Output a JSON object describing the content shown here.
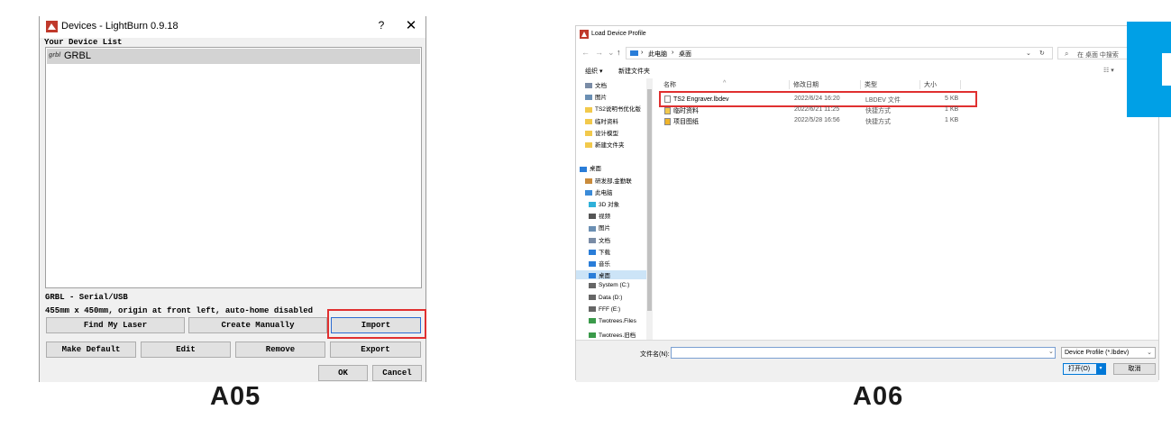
{
  "left_dialog": {
    "title": "Devices - LightBurn 0.9.18",
    "help_glyph": "?",
    "close_glyph": "✕",
    "list_label": "Your Device List",
    "devices": [
      {
        "icon_text": "grbl",
        "name": "GRBL"
      }
    ],
    "selected_device_info": "GRBL - Serial/USB",
    "device_details": "455mm x 450mm, origin at front left, auto-home disabled",
    "buttons": {
      "find_my_laser": "Find My Laser",
      "create_manually": "Create Manually",
      "import": "Import",
      "make_default": "Make Default",
      "edit": "Edit",
      "remove": "Remove",
      "export": "Export",
      "ok": "OK",
      "cancel": "Cancel"
    },
    "caption": "A05"
  },
  "right_dialog": {
    "title": "Load Device Profile",
    "breadcrumb": [
      "此电脑",
      "桌面"
    ],
    "search_placeholder": "在 桌面 中搜索",
    "toolbar": {
      "organize": "组织 ▾",
      "new_folder": "新建文件夹"
    },
    "nav_tree": [
      {
        "label": "文档",
        "icon": "document-icon"
      },
      {
        "label": "图片",
        "icon": "picture-icon"
      },
      {
        "label": "TS2说明书优化版",
        "icon": "folder-icon"
      },
      {
        "label": "临时资料",
        "icon": "folder-icon"
      },
      {
        "label": "设计模型",
        "icon": "folder-icon"
      },
      {
        "label": "新建文件夹",
        "icon": "folder-icon"
      },
      {
        "label": "桌面",
        "icon": "desktop-icon"
      },
      {
        "label": "研发部,金勤联",
        "icon": "user-icon"
      },
      {
        "label": "此电脑",
        "icon": "computer-icon"
      },
      {
        "label": "3D 对象",
        "icon": "cube-icon"
      },
      {
        "label": "视频",
        "icon": "video-icon"
      },
      {
        "label": "图片",
        "icon": "picture-icon"
      },
      {
        "label": "文档",
        "icon": "document-icon"
      },
      {
        "label": "下载",
        "icon": "download-icon"
      },
      {
        "label": "音乐",
        "icon": "music-icon"
      },
      {
        "label": "桌面",
        "icon": "desktop-icon"
      },
      {
        "label": "System (C:)",
        "icon": "drive-icon"
      },
      {
        "label": "Data (D:)",
        "icon": "drive-icon"
      },
      {
        "label": "FFF (E:)",
        "icon": "drive-icon"
      },
      {
        "label": "Twotrees.Files",
        "icon": "network-drive-icon"
      },
      {
        "label": "Twotrees.旧档",
        "icon": "network-drive-icon"
      },
      {
        "label": "库",
        "icon": "library-icon"
      }
    ],
    "columns": [
      "名称",
      "修改日期",
      "类型",
      "大小"
    ],
    "files": [
      {
        "name": "TS2 Engraver.lbdev",
        "date": "2022/6/24 16:20",
        "type": "LBDEV 文件",
        "size": "5 KB",
        "icon": "file-icon"
      },
      {
        "name": "临时资料",
        "date": "2022/6/21 11:25",
        "type": "快捷方式",
        "size": "1 KB",
        "icon": "shortcut-folder-icon"
      },
      {
        "name": "项目图纸",
        "date": "2022/5/28 16:56",
        "type": "快捷方式",
        "size": "1 KB",
        "icon": "shortcut-warning-icon"
      }
    ],
    "filename_label": "文件名(N):",
    "filename_value": "",
    "filter": "Device Profile (*.lbdev)",
    "open_button": "打开(O)",
    "cancel_button": "取消",
    "caption": "A06"
  },
  "colors": {
    "highlight_red": "#e03030",
    "accent_blue": "#00a0e6",
    "selection_blue": "#0078d7"
  }
}
